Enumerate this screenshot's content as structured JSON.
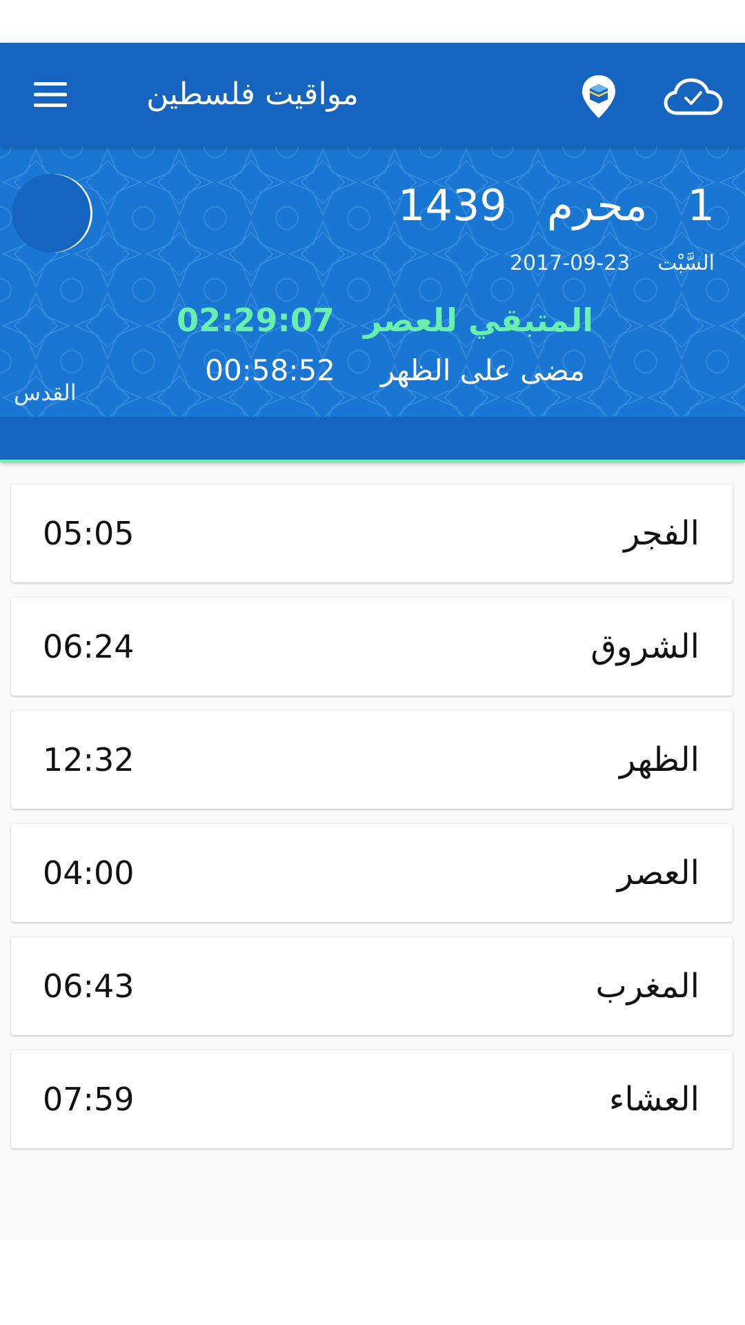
{
  "app_bar": {
    "title": "مواقيت فلسطين",
    "icons": [
      "menu-icon",
      "kaaba-location-icon",
      "cloud-check-icon"
    ],
    "background": "#1565c0"
  },
  "hero": {
    "hijri": {
      "day": "1",
      "month": "محرم",
      "year": "1439"
    },
    "weekday": "السَّبْت",
    "gregorian_date": "2017-09-23",
    "remaining_label": "المتبقي للعصر",
    "remaining_time": "02:29:07",
    "elapsed_label": "مضى على الظهر",
    "elapsed_time": "00:58:52",
    "city": "القدس",
    "colors": {
      "accent": "#69f0ae",
      "hero_bg": "#1976d2",
      "band": "#1565c0"
    }
  },
  "prayers": [
    {
      "name": "الفجر",
      "time": "05:05"
    },
    {
      "name": "الشروق",
      "time": "06:24"
    },
    {
      "name": "الظهر",
      "time": "12:32"
    },
    {
      "name": "العصر",
      "time": "04:00"
    },
    {
      "name": "المغرب",
      "time": "06:43"
    },
    {
      "name": "العشاء",
      "time": "07:59"
    }
  ]
}
